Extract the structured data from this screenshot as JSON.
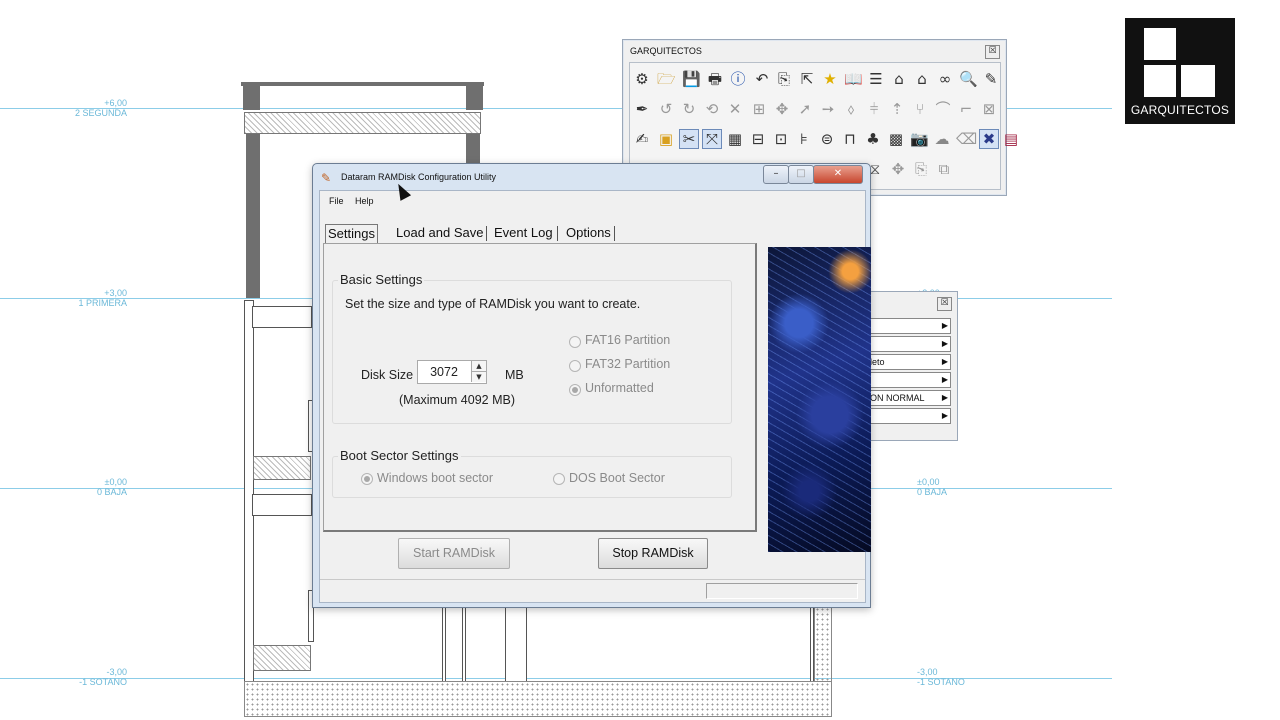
{
  "cad": {
    "levels": [
      {
        "value": "+6,00",
        "name": "2 SEGUNDA"
      },
      {
        "value": "+3,00",
        "name": "1 PRIMERA"
      },
      {
        "value": "±0,00",
        "name": "0 BAJA"
      },
      {
        "value": "-3,00",
        "name": "-1 SOTANO"
      }
    ],
    "level_color": "#8ccde8"
  },
  "logo": {
    "text": "GARQUITECTOS"
  },
  "toolbar_window": {
    "title": "GARQUITECTOS",
    "close_glyph": "☒"
  },
  "secondary_panel": {
    "close_glyph": "☒",
    "items": [
      "",
      "",
      "leto",
      "",
      "ON NORMAL",
      ""
    ],
    "arrow": "▶"
  },
  "window": {
    "title": "Dataram RAMDisk Configuration Utility",
    "caption_buttons": {
      "minimize": "–",
      "maximize": "□",
      "close": "✕"
    },
    "menu": [
      "File",
      "Help"
    ],
    "tabs": [
      "Settings",
      "Load and Save",
      "Event Log",
      "Options"
    ],
    "selected_tab": "Settings",
    "basic": {
      "heading": "Basic Settings",
      "description": "Set the size and type of RAMDisk you want to create.",
      "disk_size_label": "Disk Size",
      "disk_size_value": "3072",
      "unit": "MB",
      "maximum": "(Maximum  4092 MB)",
      "partition_options": [
        {
          "label": "FAT16 Partition",
          "checked": false
        },
        {
          "label": "FAT32 Partition",
          "checked": false
        },
        {
          "label": "Unformatted",
          "checked": true
        }
      ]
    },
    "boot": {
      "heading": "Boot Sector Settings",
      "options": [
        {
          "label": "Windows boot sector",
          "checked": true
        },
        {
          "label": "DOS Boot Sector",
          "checked": false
        }
      ]
    },
    "buttons": {
      "start": "Start RAMDisk",
      "stop": "Stop RAMDisk"
    },
    "colors": {
      "titlebar": "#d8e4f2",
      "close": "#c8462e"
    }
  }
}
